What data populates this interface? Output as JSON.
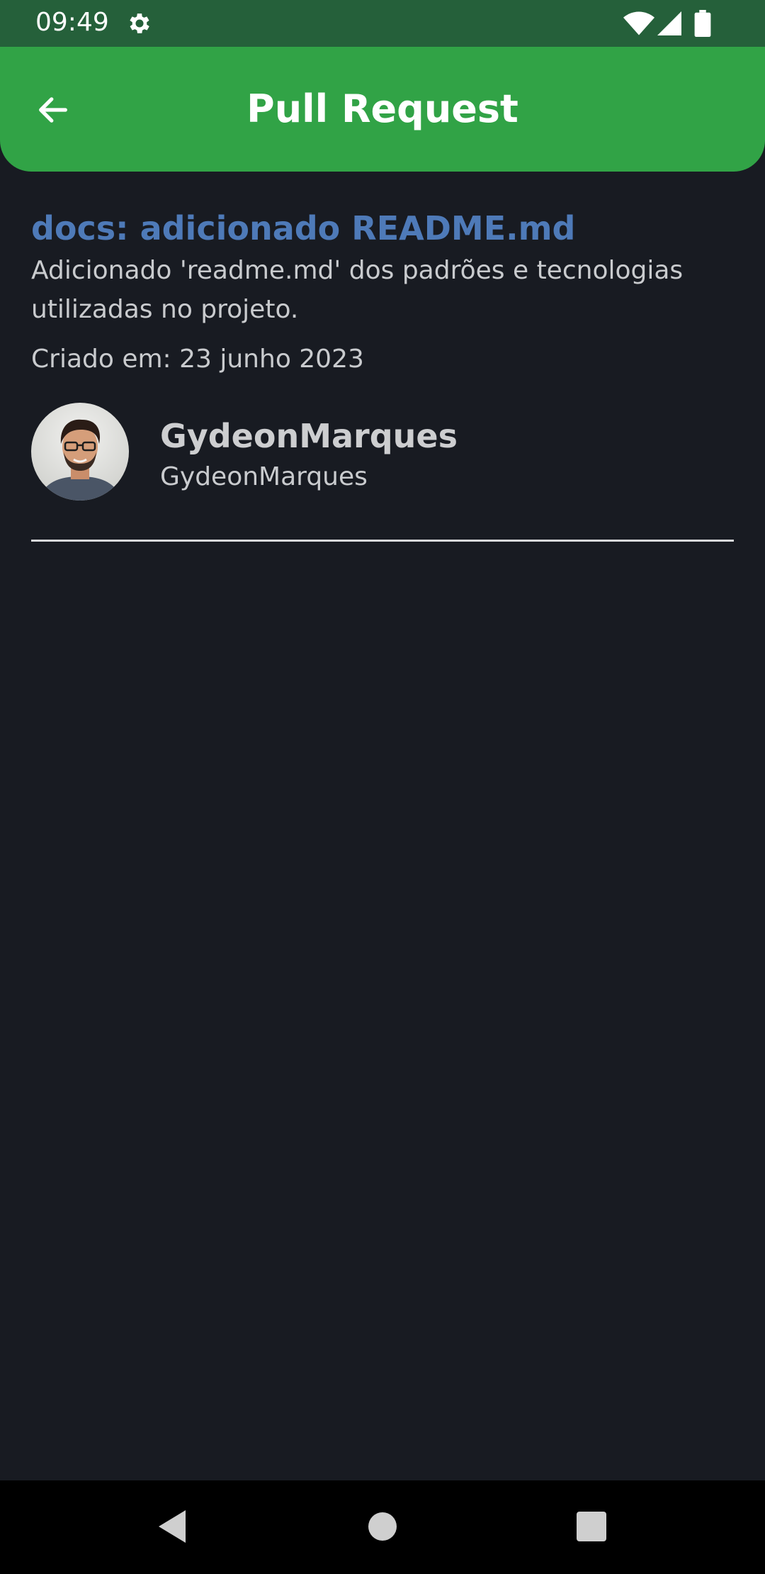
{
  "status_bar": {
    "time": "09:49",
    "icons": [
      "settings-gear-icon",
      "wifi-icon",
      "cell-signal-icon",
      "battery-icon"
    ]
  },
  "app_bar": {
    "title": "Pull Request",
    "back_icon": "arrow-back-icon"
  },
  "pull_request": {
    "title": "docs: adicionado README.md",
    "body": "Adicionado 'readme.md' dos padrões e tecnologias utilizadas no projeto.",
    "created": "Criado em: 23 junho 2023"
  },
  "author": {
    "name": "GydeonMarques",
    "login": "GydeonMarques"
  },
  "nav_bar": {
    "icons": [
      "nav-back-icon",
      "nav-home-icon",
      "nav-recents-icon"
    ]
  },
  "colors": {
    "status_bar": "#25603a",
    "app_bar": "#31a346",
    "background": "#181b22",
    "pr_title": "#4e7ab8",
    "text": "#c9cbce"
  }
}
